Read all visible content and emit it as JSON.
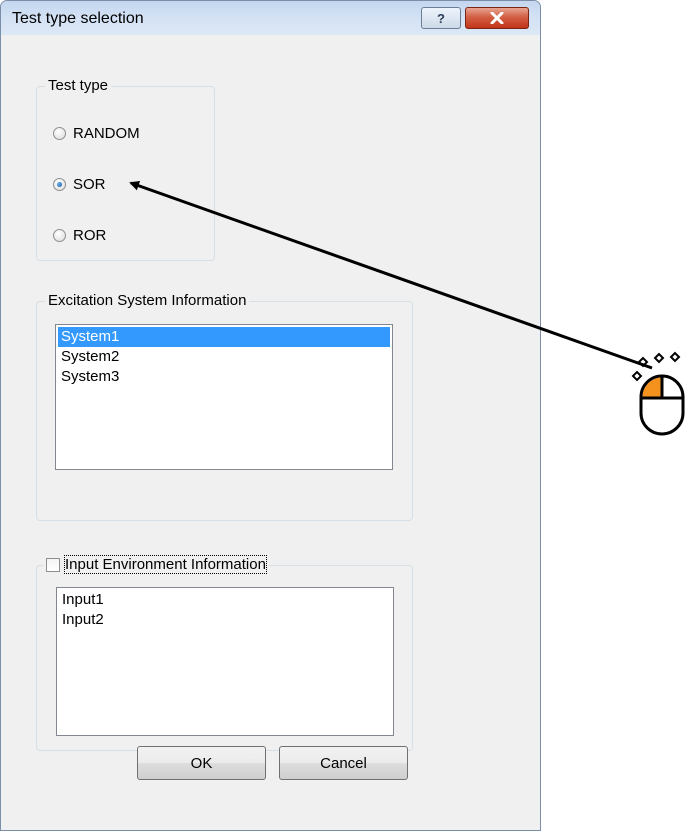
{
  "window": {
    "title": "Test type selection",
    "help_label": "?",
    "close_label": "✕"
  },
  "test_type": {
    "legend": "Test type",
    "options": [
      {
        "label": "RANDOM",
        "checked": false
      },
      {
        "label": "SOR",
        "checked": true
      },
      {
        "label": "ROR",
        "checked": false
      }
    ]
  },
  "excitation": {
    "legend": "Excitation System Information",
    "items": [
      {
        "label": "System1",
        "selected": true
      },
      {
        "label": "System2",
        "selected": false
      },
      {
        "label": "System3",
        "selected": false
      }
    ]
  },
  "input_env": {
    "legend": "Input Environment Information",
    "checked": false,
    "items": [
      "Input1",
      "Input2"
    ]
  },
  "buttons": {
    "ok": "OK",
    "cancel": "Cancel"
  },
  "colors": {
    "selection": "#3399ff",
    "mouse_button_highlight": "#f5921e"
  },
  "annotation": {
    "icon": "mouse-click-icon"
  }
}
